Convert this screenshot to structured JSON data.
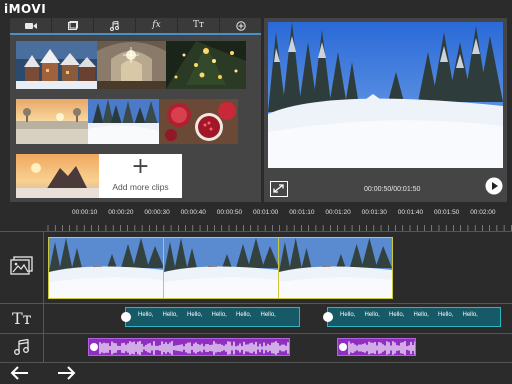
{
  "app": {
    "title": "iMOVI"
  },
  "media_browser": {
    "tabs": [
      {
        "icon": "video-camera-icon",
        "label": ""
      },
      {
        "icon": "photo-icon",
        "label": ""
      },
      {
        "icon": "music-note-icon",
        "label": ""
      },
      {
        "icon": "effects-fx-icon",
        "label": "fx"
      },
      {
        "icon": "text-icon",
        "label": "Tт"
      },
      {
        "icon": "add-circle-icon",
        "label": ""
      }
    ],
    "clips": [
      {
        "name": "village-clip",
        "subject": "town with snowy roofs"
      },
      {
        "name": "church-interior-clip",
        "subject": "church interior"
      },
      {
        "name": "christmas-tree-clip",
        "subject": "christmas tree lights"
      },
      {
        "name": "sunrise-field-clip",
        "subject": "frosty field at sunrise"
      },
      {
        "name": "snowy-forest-clip",
        "subject": "snowy forest"
      },
      {
        "name": "pomegranate-clip",
        "subject": "pomegranates"
      },
      {
        "name": "mountain-sunset-clip",
        "subject": "rocks at sunset"
      }
    ],
    "add_more_label": "Add more clips",
    "add_plus": "+"
  },
  "preview": {
    "time_display": "00:00:50/00:01:50"
  },
  "ruler": {
    "ticks": [
      "00:00:10",
      "00:00:20",
      "00:00:30",
      "00:00:40",
      "00:00:50",
      "00:01:00",
      "00:01:10",
      "00:01:20",
      "00:01:30",
      "00:01:40",
      "00:01:50",
      "00:02:00"
    ]
  },
  "timeline": {
    "text_word": "Hello,",
    "text_clips": [
      {
        "words": [
          "Hello,",
          "Hello,",
          "Hello,",
          "Hello,",
          "Hello,",
          "Hello,"
        ]
      },
      {
        "words": [
          "Hello,",
          "Hello,",
          "Hello,",
          "Hello,",
          "Hello,",
          "Hello,"
        ]
      }
    ],
    "tracks": [
      {
        "icon": "image-track-icon"
      },
      {
        "icon": "text-track-icon",
        "label": "Tт"
      },
      {
        "icon": "music-track-icon"
      }
    ]
  },
  "colors": {
    "background": "#2b2b2b",
    "panel": "#454545",
    "accent_blue": "#4a90c8",
    "video_border": "#c9c93a",
    "text_clip": "#155a66",
    "text_clip_border": "#2fb4c6",
    "audio_clip": "#8e2fc2"
  }
}
